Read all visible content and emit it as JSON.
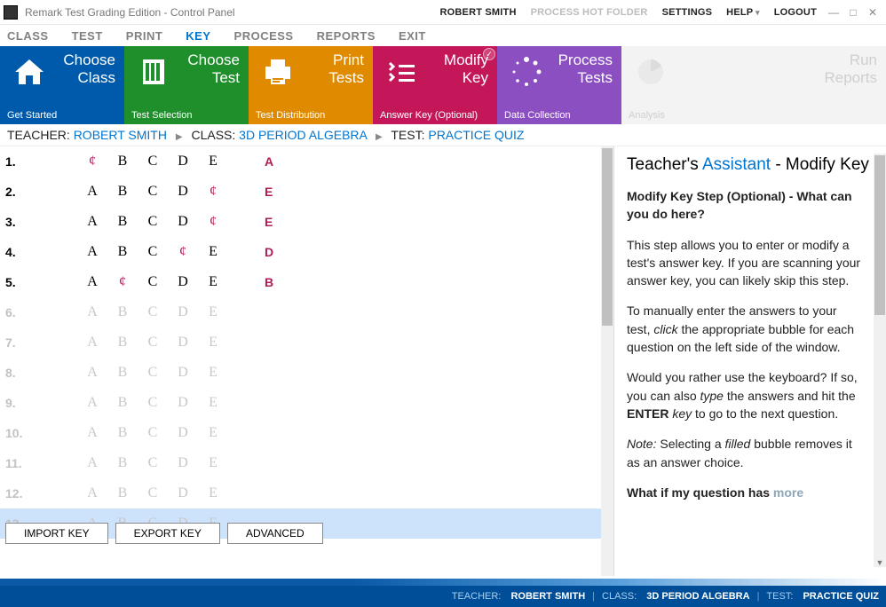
{
  "title": "Remark Test Grading Edition - Control Panel",
  "topbar": {
    "user": "ROBERT SMITH",
    "hotfolder": "PROCESS HOT FOLDER",
    "settings": "SETTINGS",
    "help": "HELP",
    "logout": "LOGOUT"
  },
  "menu": [
    "CLASS",
    "TEST",
    "PRINT",
    "KEY",
    "PROCESS",
    "REPORTS",
    "EXIT"
  ],
  "menu_active": 3,
  "tiles": [
    {
      "l1": "Choose",
      "l2": "Class",
      "sub": "Get Started"
    },
    {
      "l1": "Choose",
      "l2": "Test",
      "sub": "Test Selection"
    },
    {
      "l1": "Print",
      "l2": "Tests",
      "sub": "Test Distribution"
    },
    {
      "l1": "Modify",
      "l2": "Key",
      "sub": "Answer Key (Optional)"
    },
    {
      "l1": "Process",
      "l2": "Tests",
      "sub": "Data Collection"
    },
    {
      "l1": "Run",
      "l2": "Reports",
      "sub": "Analysis"
    }
  ],
  "breadcrumb": {
    "teacher_lbl": "TEACHER:",
    "teacher": "ROBERT SMITH",
    "class_lbl": "CLASS:",
    "class": "3D PERIOD ALGEBRA",
    "test_lbl": "TEST:",
    "test": "PRACTICE QUIZ"
  },
  "choices": [
    "A",
    "B",
    "C",
    "D",
    "E"
  ],
  "questions": [
    {
      "n": "1.",
      "filled": 0,
      "answer": "A",
      "active": true
    },
    {
      "n": "2.",
      "filled": 4,
      "answer": "E",
      "active": true
    },
    {
      "n": "3.",
      "filled": 4,
      "answer": "E",
      "active": true
    },
    {
      "n": "4.",
      "filled": 3,
      "answer": "D",
      "active": true
    },
    {
      "n": "5.",
      "filled": 1,
      "answer": "B",
      "active": true
    },
    {
      "n": "6.",
      "filled": -1,
      "answer": "",
      "active": false
    },
    {
      "n": "7.",
      "filled": -1,
      "answer": "",
      "active": false
    },
    {
      "n": "8.",
      "filled": -1,
      "answer": "",
      "active": false
    },
    {
      "n": "9.",
      "filled": -1,
      "answer": "",
      "active": false
    },
    {
      "n": "10.",
      "filled": -1,
      "answer": "",
      "active": false
    },
    {
      "n": "11.",
      "filled": -1,
      "answer": "",
      "active": false
    },
    {
      "n": "12.",
      "filled": -1,
      "answer": "",
      "active": false
    },
    {
      "n": "13.",
      "filled": -1,
      "answer": "",
      "active": false,
      "selected": true
    }
  ],
  "buttons": {
    "import": "IMPORT KEY",
    "export": "EXPORT KEY",
    "advanced": "ADVANCED"
  },
  "assistant": {
    "pre": "Teacher's ",
    "link": "Assistant",
    "post": " - Modify Key",
    "h": "Modify Key Step (Optional) - What can you do here?",
    "p1": "This step allows you to enter or modify a test's answer key. If you are scanning your answer key, you can likely skip this step.",
    "p2a": "To manually enter the answers to your test, ",
    "p2i": "click",
    "p2b": " the appropriate bubble for each question on the left side of the window.",
    "p3a": "Would you rather use the keyboard? If so, you can also ",
    "p3i": "type",
    "p3b": " the answers and hit the ",
    "p3s": "ENTER",
    "p3c": " key",
    "p3d": " to go to the next question.",
    "p4a": "Note:",
    "p4b": " Selecting a ",
    "p4i": "filled",
    "p4c": " bubble removes it as an answer choice.",
    "p5": "What if my question has ",
    "p5more": "more"
  },
  "status": {
    "teacher_lbl": "TEACHER:",
    "teacher": "ROBERT SMITH",
    "class_lbl": "CLASS:",
    "class": "3D PERIOD ALGEBRA",
    "test_lbl": "TEST:",
    "test": "PRACTICE QUIZ"
  }
}
